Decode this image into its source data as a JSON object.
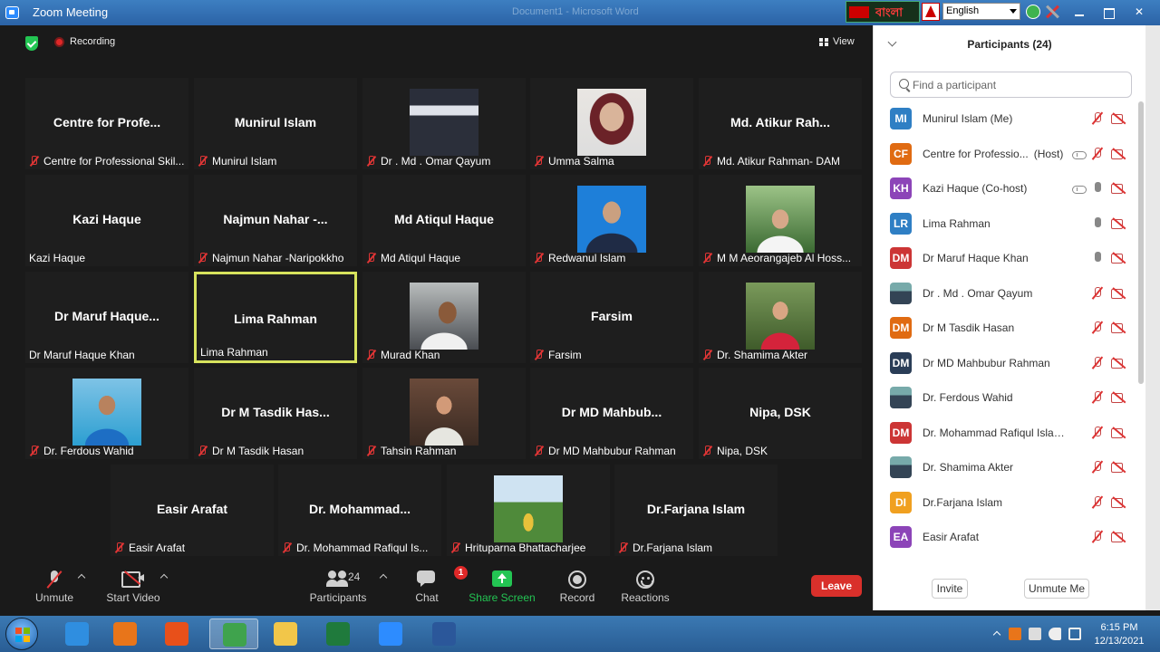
{
  "window": {
    "title": "Zoom Meeting",
    "ghost_title": "Document1 - Microsoft Word"
  },
  "lang_widget": {
    "script_text": "বাংলা",
    "language": "English"
  },
  "meeting": {
    "recording_label": "Recording",
    "view_label": "View"
  },
  "tiles": [
    {
      "name": "Centre for Profe...",
      "label": "Centre for Professional Skil...",
      "muted": true,
      "photo": ""
    },
    {
      "name": "Munirul Islam",
      "label": "Munirul Islam",
      "muted": true,
      "photo": ""
    },
    {
      "name": "",
      "label": "Dr . Md . Omar Qayum",
      "muted": true,
      "photo": "ph-1"
    },
    {
      "name": "",
      "label": "Umma Salma",
      "muted": true,
      "photo": "ph-2"
    },
    {
      "name": "Md. Atikur Rah...",
      "label": "Md. Atikur Rahman- DAM",
      "muted": true,
      "photo": ""
    },
    {
      "name": "Kazi Haque",
      "label": "Kazi Haque",
      "muted": false,
      "photo": ""
    },
    {
      "name": "Najmun Nahar -...",
      "label": "Najmun Nahar -Naripokkho",
      "muted": true,
      "photo": ""
    },
    {
      "name": "Md Atiqul Haque",
      "label": "Md Atiqul Haque",
      "muted": true,
      "photo": ""
    },
    {
      "name": "",
      "label": "Redwanul Islam",
      "muted": true,
      "photo": "ph-3"
    },
    {
      "name": "",
      "label": "M M Aeorangajeb Al Hoss...",
      "muted": true,
      "photo": "ph-4"
    },
    {
      "name": "Dr Maruf Haque...",
      "label": "Dr Maruf Haque Khan",
      "muted": false,
      "photo": ""
    },
    {
      "name": "Lima Rahman",
      "label": "Lima Rahman",
      "muted": false,
      "photo": "",
      "active": true
    },
    {
      "name": "",
      "label": "Murad Khan",
      "muted": true,
      "photo": "ph-5"
    },
    {
      "name": "Farsim",
      "label": "Farsim",
      "muted": true,
      "photo": ""
    },
    {
      "name": "",
      "label": "Dr. Shamima Akter",
      "muted": true,
      "photo": "ph-6"
    },
    {
      "name": "",
      "label": "Dr. Ferdous Wahid",
      "muted": true,
      "photo": "ph-7"
    },
    {
      "name": "Dr M Tasdik Has...",
      "label": "Dr M Tasdik Hasan",
      "muted": true,
      "photo": ""
    },
    {
      "name": "",
      "label": "Tahsin Rahman",
      "muted": true,
      "photo": "ph-8"
    },
    {
      "name": "Dr MD Mahbub...",
      "label": "Dr MD Mahbubur Rahman",
      "muted": true,
      "photo": ""
    },
    {
      "name": "Nipa, DSK",
      "label": "Nipa, DSK",
      "muted": true,
      "photo": ""
    },
    {
      "name": "Easir Arafat",
      "label": "Easir Arafat",
      "muted": true,
      "photo": ""
    },
    {
      "name": "Dr.  Mohammad...",
      "label": "Dr. Mohammad  Rafiqul  Is...",
      "muted": true,
      "photo": ""
    },
    {
      "name": "",
      "label": "Hrituparna Bhattacharjee",
      "muted": true,
      "photo": "ph-9"
    },
    {
      "name": "Dr.Farjana Islam",
      "label": "Dr.Farjana Islam",
      "muted": true,
      "photo": ""
    }
  ],
  "toolbar": {
    "unmute": "Unmute",
    "start_video": "Start Video",
    "participants": "Participants",
    "participant_count": "24",
    "chat": "Chat",
    "chat_badge": "1",
    "share_screen": "Share Screen",
    "record": "Record",
    "reactions": "Reactions",
    "leave": "Leave"
  },
  "panel": {
    "title": "Participants (24)",
    "search_placeholder": "Find a participant",
    "invite": "Invite",
    "unmute_me": "Unmute Me",
    "participants": [
      {
        "initials": "MI",
        "color": "#2f7fc4",
        "name": "Munirul Islam (Me)",
        "tag": "",
        "cloud": false,
        "mic": "muted"
      },
      {
        "initials": "CF",
        "color": "#e06b12",
        "name": "Centre for Professio...",
        "tag": "(Host)",
        "cloud": true,
        "mic": "muted"
      },
      {
        "initials": "KH",
        "color": "#8c44b8",
        "name": "Kazi Haque (Co-host)",
        "tag": "",
        "cloud": true,
        "mic": "on"
      },
      {
        "initials": "LR",
        "color": "#2f7fc4",
        "name": "Lima Rahman",
        "tag": "",
        "cloud": false,
        "mic": "on"
      },
      {
        "initials": "DM",
        "color": "#cc3535",
        "name": "Dr Maruf Haque Khan",
        "tag": "",
        "cloud": false,
        "mic": "on"
      },
      {
        "initials": "",
        "color": "",
        "name": "Dr . Md . Omar Qayum",
        "tag": "",
        "cloud": false,
        "mic": "muted",
        "photo": true
      },
      {
        "initials": "DM",
        "color": "#e06b12",
        "name": "Dr M Tasdik Hasan",
        "tag": "",
        "cloud": false,
        "mic": "muted"
      },
      {
        "initials": "DM",
        "color": "#2a3d57",
        "name": "Dr MD Mahbubur Rahman",
        "tag": "",
        "cloud": false,
        "mic": "muted"
      },
      {
        "initials": "",
        "color": "",
        "name": "Dr. Ferdous Wahid",
        "tag": "",
        "cloud": false,
        "mic": "muted",
        "photo": true
      },
      {
        "initials": "DM",
        "color": "#cc3535",
        "name": "Dr. Mohammad  Rafiqul  Islam ...",
        "tag": "",
        "cloud": false,
        "mic": "muted"
      },
      {
        "initials": "",
        "color": "",
        "name": "Dr. Shamima Akter",
        "tag": "",
        "cloud": false,
        "mic": "muted",
        "photo": true
      },
      {
        "initials": "DI",
        "color": "#f0a020",
        "name": "Dr.Farjana Islam",
        "tag": "",
        "cloud": false,
        "mic": "muted"
      },
      {
        "initials": "EA",
        "color": "#8c44b8",
        "name": "Easir Arafat",
        "tag": "",
        "cloud": false,
        "mic": "muted"
      }
    ]
  },
  "taskbar": {
    "apps": [
      {
        "name": "internet-explorer",
        "color": "#2f8ee0"
      },
      {
        "name": "media-player",
        "color": "#e8751a"
      },
      {
        "name": "firefox",
        "color": "#e8501a"
      },
      {
        "name": "chrome",
        "color": "#3fa34d"
      },
      {
        "name": "file-explorer",
        "color": "#f2c649"
      },
      {
        "name": "excel",
        "color": "#1f7a3c"
      },
      {
        "name": "zoom",
        "color": "#2d8cff"
      },
      {
        "name": "word",
        "color": "#2b579a"
      }
    ],
    "time": "6:15 PM",
    "date": "12/13/2021"
  }
}
